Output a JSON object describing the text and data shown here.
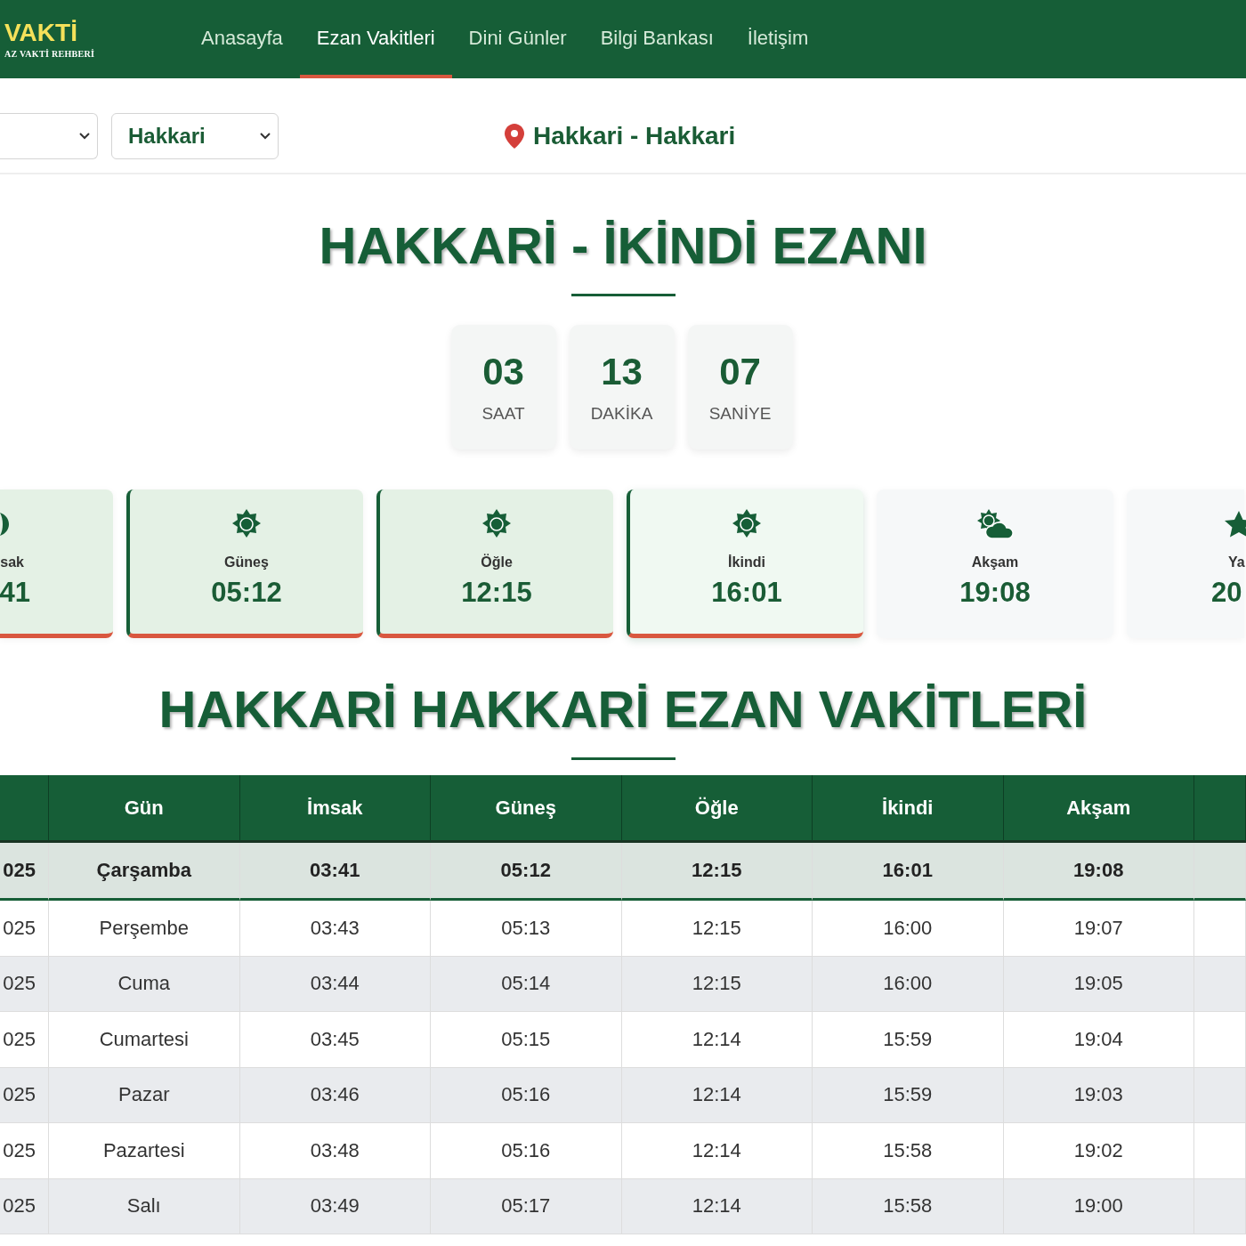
{
  "header": {
    "logo_title": "VAKTİ",
    "logo_subtitle": "AZ VAKTİ REHBERİ",
    "nav": [
      {
        "label": "Anasayfa",
        "selected": false
      },
      {
        "label": "Ezan Vakitleri",
        "selected": true
      },
      {
        "label": "Dini Günler",
        "selected": false
      },
      {
        "label": "Bilgi Bankası",
        "selected": false
      },
      {
        "label": "İletişim",
        "selected": false
      }
    ]
  },
  "location_bar": {
    "district_select": {
      "value": "Hakkari"
    },
    "location": "Hakkari - Hakkari"
  },
  "countdown": {
    "title": "HAKKARİ - İKİNDİ EZANI",
    "units": [
      {
        "value": "03",
        "label": "SAAT"
      },
      {
        "value": "13",
        "label": "DAKİKA"
      },
      {
        "value": "07",
        "label": "SANİYE"
      }
    ]
  },
  "prayer_cards": [
    {
      "name": "sak",
      "time": "41",
      "passed": true,
      "current": false
    },
    {
      "name": "Güneş",
      "time": "05:12",
      "passed": true,
      "current": false
    },
    {
      "name": "Öğle",
      "time": "12:15",
      "passed": true,
      "current": false
    },
    {
      "name": "İkindi",
      "time": "16:01",
      "passed": true,
      "current": true
    },
    {
      "name": "Akşam",
      "time": "19:08",
      "passed": false,
      "current": false
    },
    {
      "name": "Ya",
      "time": "20",
      "passed": false,
      "current": false
    }
  ],
  "table": {
    "title": "HAKKARİ HAKKARİ EZAN VAKİTLERİ",
    "columns": [
      "Gün",
      "İmsak",
      "Güneş",
      "Öğle",
      "İkindi",
      "Akşam"
    ],
    "rows": [
      {
        "date": "025",
        "day": "Çarşamba",
        "times": [
          "03:41",
          "05:12",
          "12:15",
          "16:01",
          "19:08"
        ],
        "selected": true
      },
      {
        "date": "025",
        "day": "Perşembe",
        "times": [
          "03:43",
          "05:13",
          "12:15",
          "16:00",
          "19:07"
        ],
        "selected": false
      },
      {
        "date": "025",
        "day": "Cuma",
        "times": [
          "03:44",
          "05:14",
          "12:15",
          "16:00",
          "19:05"
        ],
        "selected": false
      },
      {
        "date": "025",
        "day": "Cumartesi",
        "times": [
          "03:45",
          "05:15",
          "12:14",
          "15:59",
          "19:04"
        ],
        "selected": false
      },
      {
        "date": "025",
        "day": "Pazar",
        "times": [
          "03:46",
          "05:16",
          "12:14",
          "15:59",
          "19:03"
        ],
        "selected": false
      },
      {
        "date": "025",
        "day": "Pazartesi",
        "times": [
          "03:48",
          "05:16",
          "12:14",
          "15:58",
          "19:02"
        ],
        "selected": false
      },
      {
        "date": "025",
        "day": "Salı",
        "times": [
          "03:49",
          "05:17",
          "12:14",
          "15:58",
          "19:00"
        ],
        "selected": false
      }
    ]
  }
}
